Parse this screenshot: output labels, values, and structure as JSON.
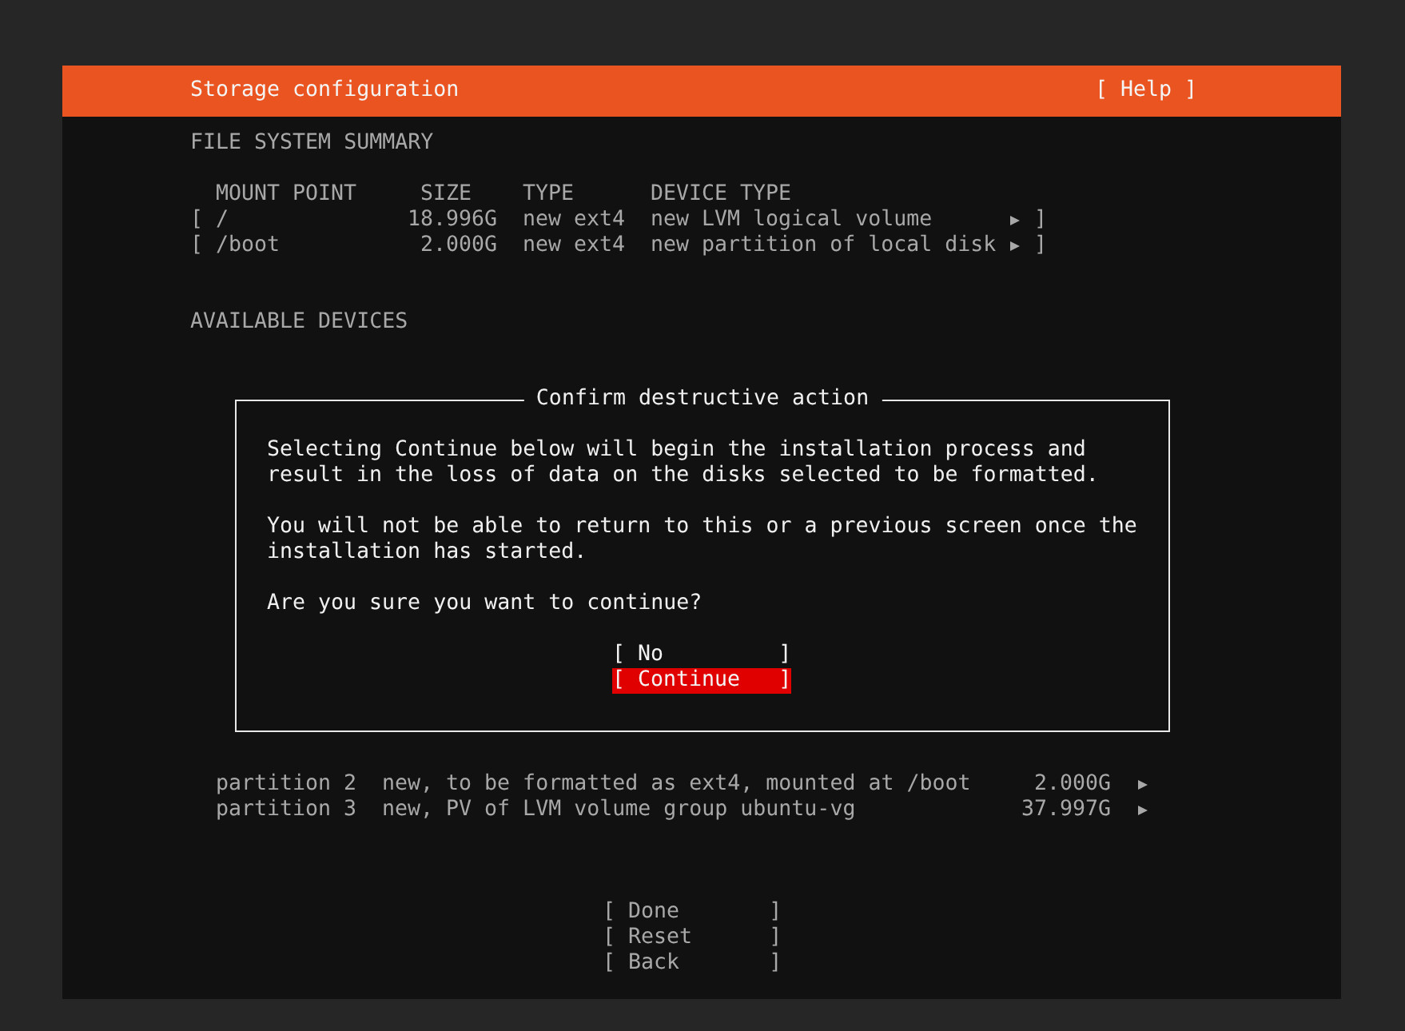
{
  "header": {
    "title": "Storage configuration",
    "help": "[ Help ]"
  },
  "file_system_summary": {
    "heading": "FILE SYSTEM SUMMARY",
    "columns": [
      "MOUNT POINT",
      "SIZE",
      "TYPE",
      "DEVICE TYPE"
    ],
    "rows": [
      {
        "open": "[",
        "mount_point": "/",
        "size": "18.996G",
        "type": "new ext4",
        "device_type": "new LVM logical volume",
        "close": "]"
      },
      {
        "open": "[",
        "mount_point": "/boot",
        "size": "2.000G",
        "type": "new ext4",
        "device_type": "new partition of local disk",
        "close": "]"
      }
    ]
  },
  "available_devices": {
    "heading": "AVAILABLE DEVICES",
    "rows": [
      {
        "name": "partition 2",
        "description": "new, to be formatted as ext4, mounted at /boot",
        "size": "2.000G"
      },
      {
        "name": "partition 3",
        "description": "new, PV of LVM volume group ubuntu-vg",
        "size": "37.997G"
      }
    ]
  },
  "dialog": {
    "title": "Confirm destructive action",
    "paragraphs": [
      "Selecting Continue below will begin the installation process and\nresult in the loss of data on the disks selected to be formatted.",
      "You will not be able to return to this or a previous screen once the\ninstallation has started.",
      "Are you sure you want to continue?"
    ],
    "buttons": [
      {
        "label": "[ No         ]",
        "selected": false
      },
      {
        "label": "[ Continue   ]",
        "selected": true
      }
    ]
  },
  "actions": [
    "[ Done       ]",
    "[ Reset      ]",
    "[ Back       ]"
  ]
}
